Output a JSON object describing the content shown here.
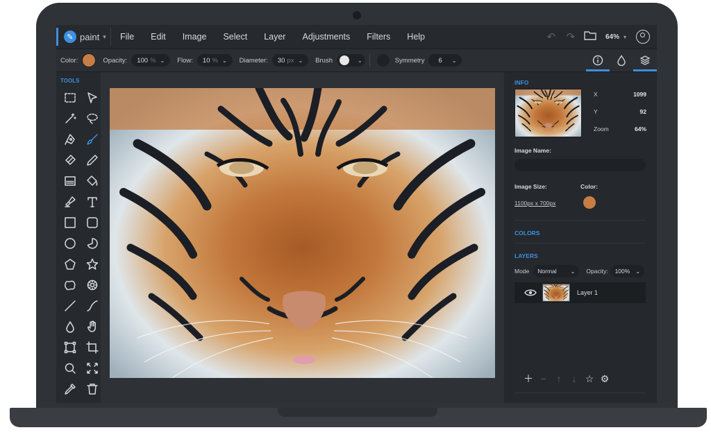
{
  "app": {
    "name": "paint",
    "menu": [
      "File",
      "Edit",
      "Image",
      "Select",
      "Layer",
      "Adjustments",
      "Filters",
      "Help"
    ],
    "zoom": "64%"
  },
  "options": {
    "color_label": "Color:",
    "color_value": "#c77e45",
    "opacity_label": "Opacity:",
    "opacity_value": "100",
    "opacity_unit": "%",
    "flow_label": "Flow:",
    "flow_value": "10",
    "flow_unit": "%",
    "diameter_label": "Diameter:",
    "diameter_value": "30",
    "diameter_unit": "px",
    "brush_label": "Brush",
    "symmetry_label": "Symmetry",
    "symmetry_value": "6"
  },
  "tools": {
    "title": "TOOLS",
    "items": [
      {
        "name": "rect-select-icon",
        "active": false
      },
      {
        "name": "pointer-icon",
        "active": false
      },
      {
        "name": "magic-wand-icon",
        "active": false
      },
      {
        "name": "lasso-icon",
        "active": false
      },
      {
        "name": "pen-icon",
        "active": false
      },
      {
        "name": "brush-icon",
        "active": true
      },
      {
        "name": "eraser-icon",
        "active": false
      },
      {
        "name": "pencil-icon",
        "active": false
      },
      {
        "name": "gradient-icon",
        "active": false
      },
      {
        "name": "fill-bucket-icon",
        "active": false
      },
      {
        "name": "clone-stamp-icon",
        "active": false
      },
      {
        "name": "text-icon",
        "active": false
      },
      {
        "name": "rectangle-icon",
        "active": false
      },
      {
        "name": "rounded-rectangle-icon",
        "active": false
      },
      {
        "name": "circle-icon",
        "active": false
      },
      {
        "name": "pie-icon",
        "active": false
      },
      {
        "name": "pentagon-icon",
        "active": false
      },
      {
        "name": "star-icon",
        "active": false
      },
      {
        "name": "cloud-shape-icon",
        "active": false
      },
      {
        "name": "gear-shape-icon",
        "active": false
      },
      {
        "name": "line-icon",
        "active": false
      },
      {
        "name": "curve-icon",
        "active": false
      },
      {
        "name": "blur-drop-icon",
        "active": false
      },
      {
        "name": "hand-icon",
        "active": false
      },
      {
        "name": "transform-icon",
        "active": false
      },
      {
        "name": "crop-icon",
        "active": false
      },
      {
        "name": "zoom-icon",
        "active": false
      },
      {
        "name": "fit-screen-icon",
        "active": false
      },
      {
        "name": "eyedropper-icon",
        "active": false
      },
      {
        "name": "trash-icon",
        "active": false
      }
    ]
  },
  "info": {
    "title": "INFO",
    "x_label": "X",
    "x_value": "1099",
    "y_label": "Y",
    "y_value": "92",
    "zoom_label": "Zoom",
    "zoom_value": "64%",
    "image_name_label": "Image Name:",
    "image_name_value": "",
    "image_size_label": "Image Size:",
    "image_size_value": "1100px x 700px",
    "color_label": "Color:",
    "color_value": "#c77e45"
  },
  "colors": {
    "title": "COLORS"
  },
  "layers": {
    "title": "LAYERS",
    "mode_label": "Mode",
    "mode_value": "Normal",
    "opacity_label": "Opacity:",
    "opacity_value": "100%",
    "items": [
      {
        "name": "Layer 1",
        "visible": true
      }
    ]
  },
  "accent_color": "#3d8fe0"
}
